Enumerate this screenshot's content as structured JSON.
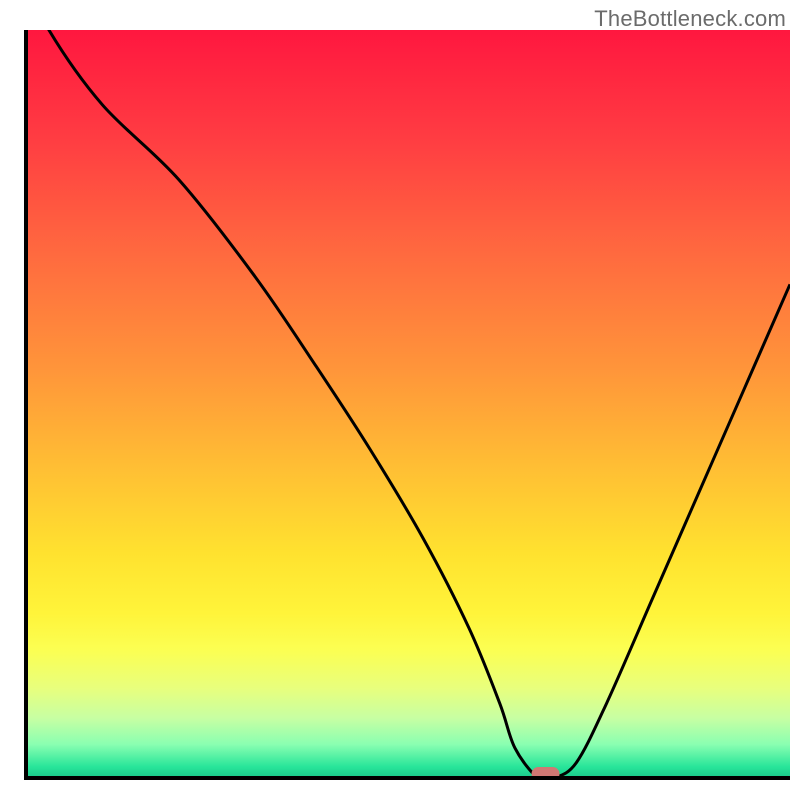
{
  "watermark": "TheBottleneck.com",
  "chart_data": {
    "type": "line",
    "title": "",
    "xlabel": "",
    "ylabel": "",
    "xlim": [
      0,
      100
    ],
    "ylim": [
      0,
      100
    ],
    "x": [
      0,
      3,
      10,
      20,
      30,
      38,
      45,
      52,
      58,
      62,
      64,
      67,
      69,
      72,
      76,
      82,
      88,
      94,
      100
    ],
    "values": [
      107,
      100,
      90,
      80,
      67,
      55,
      44,
      32,
      20,
      10,
      4,
      0,
      0,
      2,
      10,
      24,
      38,
      52,
      66
    ],
    "marker": {
      "x": 68,
      "y": 0
    },
    "gradient_stops": [
      {
        "offset": 0.0,
        "color": "#ff173f"
      },
      {
        "offset": 0.14,
        "color": "#ff3b42"
      },
      {
        "offset": 0.3,
        "color": "#ff6a3f"
      },
      {
        "offset": 0.45,
        "color": "#ff943a"
      },
      {
        "offset": 0.58,
        "color": "#ffbd34"
      },
      {
        "offset": 0.7,
        "color": "#ffe22f"
      },
      {
        "offset": 0.78,
        "color": "#fff43a"
      },
      {
        "offset": 0.83,
        "color": "#fbff53"
      },
      {
        "offset": 0.88,
        "color": "#e8ff7d"
      },
      {
        "offset": 0.92,
        "color": "#c7ffa3"
      },
      {
        "offset": 0.955,
        "color": "#8affb1"
      },
      {
        "offset": 0.985,
        "color": "#28e59a"
      },
      {
        "offset": 1.0,
        "color": "#19c98a"
      }
    ],
    "axis_color": "#000000",
    "line_color": "#000000",
    "marker_color": "#d07874"
  }
}
